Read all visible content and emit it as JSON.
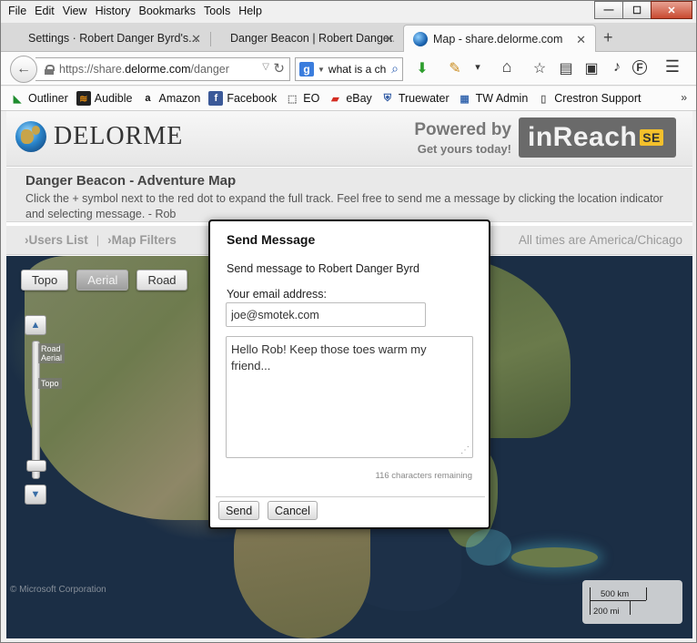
{
  "menu": [
    "File",
    "Edit",
    "View",
    "History",
    "Bookmarks",
    "Tools",
    "Help"
  ],
  "window_controls": {
    "minimize": "—",
    "maximize": "☐",
    "close": "✕"
  },
  "tabs": [
    {
      "label": "Settings · Robert Danger Byrd's..."
    },
    {
      "label": "Danger Beacon | Robert Danger..."
    },
    {
      "label": "Map - share.delorme.com"
    }
  ],
  "tab_close_glyph": "✕",
  "new_tab_glyph": "+",
  "nav": {
    "back_glyph": "←",
    "url_prefix": "https://share.",
    "url_domain": "delorme.com",
    "url_path": "/danger",
    "dropdown_glyph": "▽",
    "reload_glyph": "↻",
    "search_engine_glyph": "g",
    "search_text": "what is a ch",
    "search_glyph": "⌕"
  },
  "toolbar_icons": [
    "download-icon",
    "pencil-icon",
    "dropdown-arrow-icon",
    "home-icon",
    "star-icon",
    "reader-icon",
    "screenshot-icon",
    "extension-icon",
    "profile-icon",
    "menu-icon"
  ],
  "toolbar_glyphs": {
    "download": "⬇",
    "pencil": "✎",
    "dropdown": "▾",
    "home": "⌂",
    "star": "☆",
    "reader": "▤",
    "screenshot": "▣",
    "extension": "♪",
    "profile": "F",
    "menu": "☰"
  },
  "bookmarks": [
    {
      "label": "Outliner",
      "glyph": "◣"
    },
    {
      "label": "Audible",
      "glyph": "≋"
    },
    {
      "label": "Amazon",
      "glyph": "a"
    },
    {
      "label": "Facebook",
      "glyph": "f"
    },
    {
      "label": "EO",
      "glyph": "⬚"
    },
    {
      "label": "eBay",
      "glyph": "▰"
    },
    {
      "label": "Truewater",
      "glyph": "⛨"
    },
    {
      "label": "TW Admin",
      "glyph": "▦"
    },
    {
      "label": "Crestron Support",
      "glyph": "▯"
    }
  ],
  "bookmarks_more": "»",
  "site": {
    "logo": "DELORME",
    "powered_line1": "Powered by",
    "powered_line2": "Get yours today!",
    "product": "inReach",
    "product_badge": "SE"
  },
  "info": {
    "title": "Danger Beacon - Adventure Map",
    "text": "Click the + symbol next to the red dot to expand the full track. Feel free to send me a message by clicking the location indicator and selecting message. - Rob"
  },
  "filters": {
    "users_list": "Users List",
    "map_filters": "Map Filters",
    "separator": "|",
    "arrow": "›",
    "timezone": "All times are America/Chicago"
  },
  "map": {
    "types": [
      "Topo",
      "Aerial",
      "Road"
    ],
    "active_type": "Aerial",
    "zoom_up": "▲",
    "zoom_down": "▼",
    "zoom_labels": [
      "Road Aerial",
      "Topo"
    ],
    "copyright": "© Microsoft Corporation",
    "scale_km": "500 km",
    "scale_mi": "200 mi"
  },
  "dialog": {
    "title": "Send Message",
    "to_text": "Send message to Robert Danger Byrd",
    "email_label": "Your email address:",
    "email_value": "joe@smotek.com",
    "message_value": "Hello Rob! Keep those toes warm my friend...",
    "remaining": "116 characters remaining",
    "send_label": "Send",
    "cancel_label": "Cancel"
  }
}
